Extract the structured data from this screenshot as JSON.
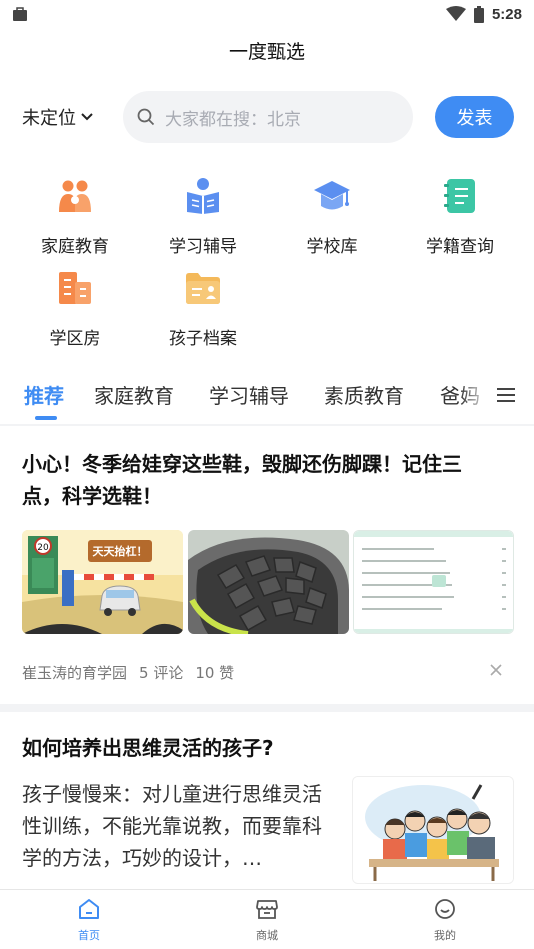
{
  "status_bar": {
    "time": "5:28",
    "icons": [
      "bag-icon",
      "wifi-icon",
      "battery-icon"
    ]
  },
  "header": {
    "title": "一度甄选"
  },
  "search_row": {
    "location": "未定位",
    "search_placeholder": "大家都在搜：北京",
    "publish_label": "发表"
  },
  "categories": [
    {
      "label": "家庭教育",
      "icon": "family-icon"
    },
    {
      "label": "学习辅导",
      "icon": "study-icon"
    },
    {
      "label": "学校库",
      "icon": "graduation-cap-icon"
    },
    {
      "label": "学籍查询",
      "icon": "notebook-icon"
    },
    {
      "label": "学区房",
      "icon": "building-icon"
    },
    {
      "label": "孩子档案",
      "icon": "folder-icon"
    }
  ],
  "tabs": [
    "推荐",
    "家庭教育",
    "学习辅导",
    "素质教育",
    "爸妈"
  ],
  "active_tab": "推荐",
  "article1": {
    "title_line1": "小心！冬季给娃穿这些鞋，毁脚还伤脚踝！记住三",
    "title_line2": "点，科学选鞋！",
    "thumb1_sign": "天天抬杠！",
    "thumb1_speed": "20",
    "author": "崔玉涛的育学园",
    "comments": "5 评论",
    "likes": "10 赞"
  },
  "article2": {
    "title": "如何培养出思维灵活的孩子?",
    "body": "孩子慢慢来：对儿童进行思维灵活性训练，不能光靠说教，而要靠科学的方法，巧妙的设计，…"
  },
  "bottom_nav": [
    {
      "label": "首页",
      "icon": "home-icon",
      "active": true
    },
    {
      "label": "商城",
      "icon": "shop-icon",
      "active": false
    },
    {
      "label": "我的",
      "icon": "smile-icon",
      "active": false
    }
  ],
  "colors": {
    "accent": "#3f8cf3",
    "icon_orange": "#f5894a",
    "icon_blue": "#5b8ff0",
    "icon_teal": "#3cc6a5",
    "icon_yellow": "#f4b95a"
  }
}
